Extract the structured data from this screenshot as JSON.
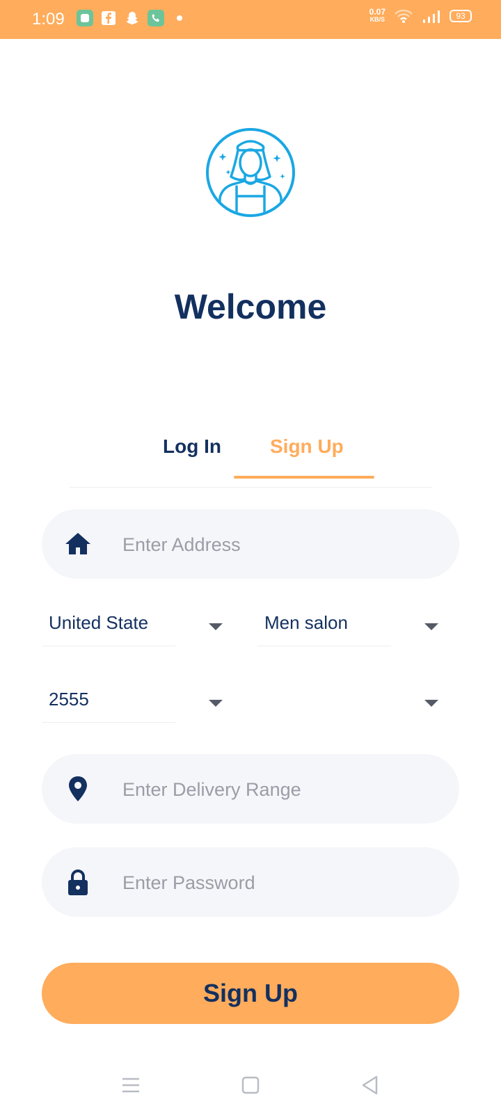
{
  "status_bar": {
    "time": "1:09",
    "net_speed_value": "0.07",
    "net_speed_unit": "KB/S",
    "battery": "93",
    "icons": [
      "message-app-icon",
      "facebook-icon",
      "snapchat-icon",
      "phone-app-icon",
      "notification-dot",
      "wifi-icon",
      "signal-icon",
      "battery-icon"
    ]
  },
  "header": {
    "avatar_icon": "female-worker-avatar-icon",
    "title": "Welcome"
  },
  "tabs": {
    "login_label": "Log In",
    "signup_label": "Sign Up",
    "active": "Sign Up"
  },
  "form": {
    "address": {
      "placeholder": "Enter Address",
      "value": "",
      "icon": "home-icon"
    },
    "country": {
      "value": "United State"
    },
    "category": {
      "value": "Men salon"
    },
    "zip": {
      "value": "2555"
    },
    "city": {
      "value": ""
    },
    "delivery_range": {
      "placeholder": "Enter Delivery Range",
      "value": "",
      "icon": "location-pin-icon"
    },
    "password": {
      "placeholder": "Enter Password",
      "value": "",
      "icon": "lock-icon"
    }
  },
  "submit_label": "Sign Up",
  "colors": {
    "accent": "#FFAC5C",
    "primary_text": "#13305F",
    "input_bg": "#F5F6FA",
    "avatar_blue": "#1AA7E3"
  },
  "nav_bar": {
    "icons": [
      "menu-icon",
      "home-square-icon",
      "back-triangle-icon"
    ]
  }
}
